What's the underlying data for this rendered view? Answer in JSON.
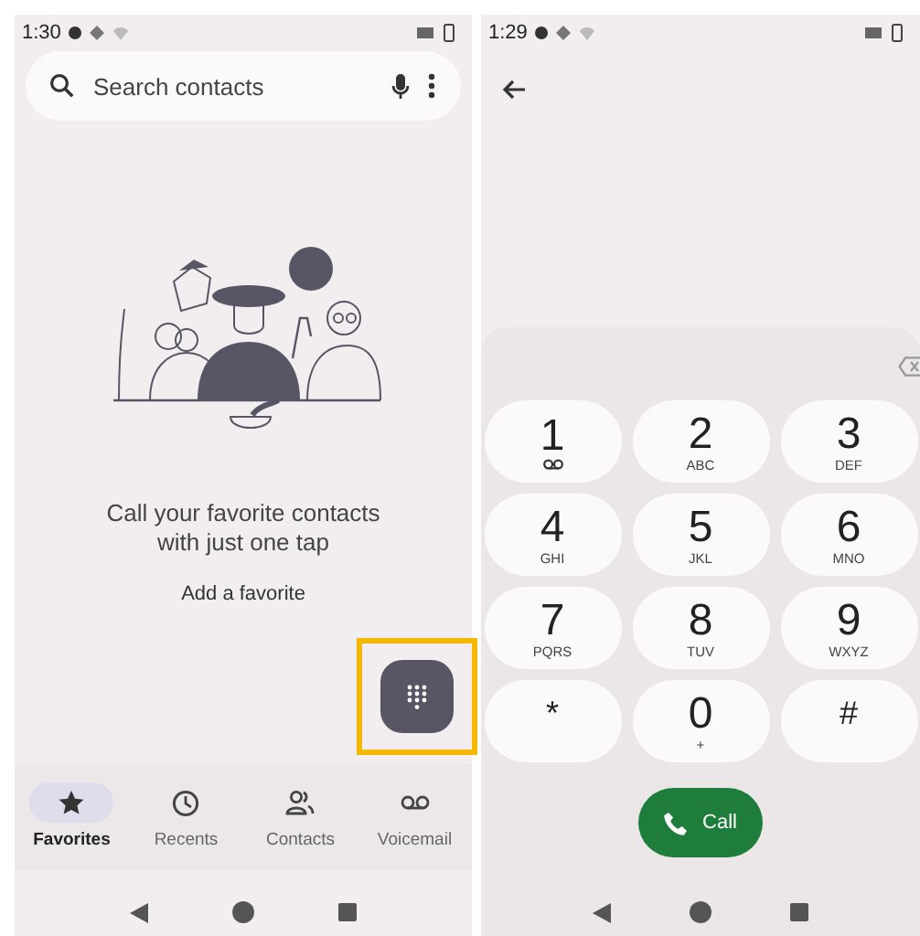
{
  "left": {
    "status_bar": {
      "time": "1:30"
    },
    "search": {
      "placeholder": "Search contacts"
    },
    "empty_state": {
      "message": "Call your favorite contacts with just one tap",
      "action": "Add a favorite"
    },
    "fab": {
      "highlighted": true
    },
    "nav": [
      {
        "label": "Favorites",
        "kind": "star",
        "selected": true
      },
      {
        "label": "Recents",
        "kind": "clock",
        "selected": false
      },
      {
        "label": "Contacts",
        "kind": "people",
        "selected": false
      },
      {
        "label": "Voicemail",
        "kind": "voicemail",
        "selected": false
      }
    ]
  },
  "right": {
    "status_bar": {
      "time": "1:29"
    },
    "keys": [
      {
        "digit": "1",
        "kind": "voicemail"
      },
      {
        "digit": "2",
        "sub": "ABC",
        "kind": "letters"
      },
      {
        "digit": "3",
        "sub": "DEF",
        "kind": "letters"
      },
      {
        "digit": "4",
        "sub": "GHI",
        "kind": "letters"
      },
      {
        "digit": "5",
        "sub": "JKL",
        "kind": "letters"
      },
      {
        "digit": "6",
        "sub": "MNO",
        "kind": "letters"
      },
      {
        "digit": "7",
        "sub": "PQRS",
        "kind": "letters"
      },
      {
        "digit": "8",
        "sub": "TUV",
        "kind": "letters"
      },
      {
        "digit": "9",
        "sub": "WXYZ",
        "kind": "letters"
      },
      {
        "digit": "*",
        "kind": "symbol"
      },
      {
        "digit": "0",
        "sub": "+",
        "kind": "letters"
      },
      {
        "digit": "#",
        "kind": "symbol"
      }
    ],
    "call_button": {
      "label": "Call"
    }
  }
}
